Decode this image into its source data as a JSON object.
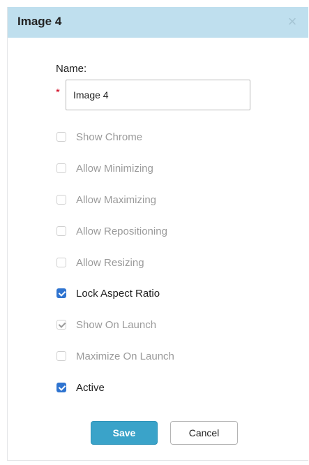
{
  "dialog": {
    "title": "Image 4",
    "close_glyph": "×"
  },
  "form": {
    "name_label": "Name:",
    "required_marker": "*",
    "name_value": "Image 4"
  },
  "options": [
    {
      "label": "Show Chrome",
      "checked": false,
      "enabled": false
    },
    {
      "label": "Allow Minimizing",
      "checked": false,
      "enabled": false
    },
    {
      "label": "Allow Maximizing",
      "checked": false,
      "enabled": false
    },
    {
      "label": "Allow Repositioning",
      "checked": false,
      "enabled": false
    },
    {
      "label": "Allow Resizing",
      "checked": false,
      "enabled": false
    },
    {
      "label": "Lock Aspect Ratio",
      "checked": true,
      "enabled": true
    },
    {
      "label": "Show On Launch",
      "checked": true,
      "enabled": false
    },
    {
      "label": "Maximize On Launch",
      "checked": false,
      "enabled": false
    },
    {
      "label": "Active",
      "checked": true,
      "enabled": true
    }
  ],
  "buttons": {
    "save_label": "Save",
    "cancel_label": "Cancel"
  },
  "colors": {
    "titlebar": "#bfdfee",
    "accent": "#3aa3c9",
    "checkbox_checked": "#2f74d0",
    "required": "#d0021b"
  }
}
